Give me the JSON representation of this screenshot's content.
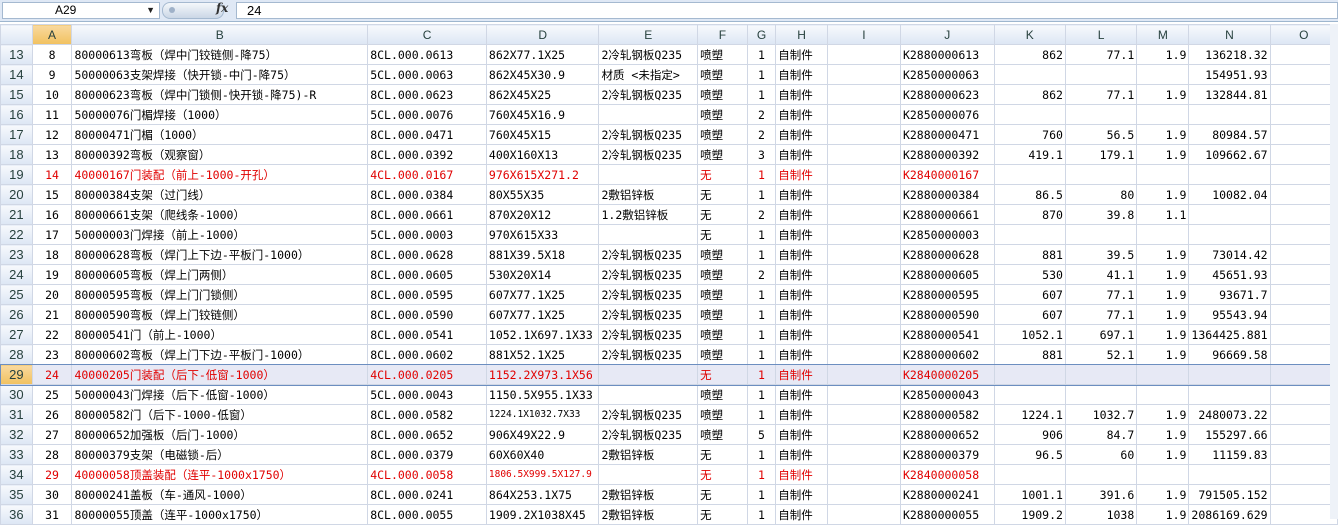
{
  "formula_bar": {
    "cell_ref": "A29",
    "fx_label": "fx",
    "value": "24"
  },
  "columns": [
    "A",
    "B",
    "C",
    "D",
    "E",
    "F",
    "G",
    "H",
    "I",
    "J",
    "K",
    "L",
    "M",
    "N",
    "O"
  ],
  "selected_column": "A",
  "selected_row": "29",
  "rows": [
    {
      "r": "13",
      "cells": [
        "8",
        "80000613弯板（焊中门铰链侧-降75）",
        "8CL.000.0613",
        "862X77.1X25",
        "2冷轧钢板Q235",
        "喷塑",
        "1",
        "自制件",
        "",
        "K2880000613",
        "862",
        "77.1",
        "1.9",
        "136218.32",
        ""
      ],
      "red": false
    },
    {
      "r": "14",
      "cells": [
        "9",
        "50000063支架焊接（快开锁-中门-降75）",
        "5CL.000.0063",
        "862X45X30.9",
        "材质 <未指定>",
        "喷塑",
        "1",
        "自制件",
        "",
        "K2850000063",
        "",
        "",
        "",
        "154951.93",
        ""
      ],
      "red": false
    },
    {
      "r": "15",
      "cells": [
        "10",
        "80000623弯板（焊中门锁侧-快开锁-降75)-R",
        "8CL.000.0623",
        "862X45X25",
        "2冷轧钢板Q235",
        "喷塑",
        "1",
        "自制件",
        "",
        "K2880000623",
        "862",
        "77.1",
        "1.9",
        "132844.81",
        ""
      ],
      "red": false
    },
    {
      "r": "16",
      "cells": [
        "11",
        "50000076门楣焊接（1000）",
        "5CL.000.0076",
        "760X45X16.9",
        "",
        "喷塑",
        "2",
        "自制件",
        "",
        "K2850000076",
        "",
        "",
        "",
        "",
        ""
      ],
      "red": false
    },
    {
      "r": "17",
      "cells": [
        "12",
        "80000471门楣（1000）",
        "8CL.000.0471",
        "760X45X15",
        "2冷轧钢板Q235",
        "喷塑",
        "2",
        "自制件",
        "",
        "K2880000471",
        "760",
        "56.5",
        "1.9",
        "80984.57",
        ""
      ],
      "red": false
    },
    {
      "r": "18",
      "cells": [
        "13",
        "80000392弯板（观察窗）",
        "8CL.000.0392",
        "400X160X13",
        "2冷轧钢板Q235",
        "喷塑",
        "3",
        "自制件",
        "",
        "K2880000392",
        "419.1",
        "179.1",
        "1.9",
        "109662.67",
        ""
      ],
      "red": false
    },
    {
      "r": "19",
      "cells": [
        "14",
        "40000167门装配（前上-1000-开孔）",
        "4CL.000.0167",
        "976X615X271.2",
        "",
        "无",
        "1",
        "自制件",
        "",
        "K2840000167",
        "",
        "",
        "",
        "",
        ""
      ],
      "red": true
    },
    {
      "r": "20",
      "cells": [
        "15",
        "80000384支架（过门线）",
        "8CL.000.0384",
        "80X55X35",
        "2敷铝锌板",
        "无",
        "1",
        "自制件",
        "",
        "K2880000384",
        "86.5",
        "80",
        "1.9",
        "10082.04",
        ""
      ],
      "red": false
    },
    {
      "r": "21",
      "cells": [
        "16",
        "80000661支架（爬线条-1000）",
        "8CL.000.0661",
        "870X20X12",
        "1.2敷铝锌板",
        "无",
        "2",
        "自制件",
        "",
        "K2880000661",
        "870",
        "39.8",
        "1.1",
        "",
        ""
      ],
      "red": false
    },
    {
      "r": "22",
      "cells": [
        "17",
        "50000003门焊接（前上-1000）",
        "5CL.000.0003",
        "970X615X33",
        "",
        "无",
        "1",
        "自制件",
        "",
        "K2850000003",
        "",
        "",
        "",
        "",
        ""
      ],
      "red": false
    },
    {
      "r": "23",
      "cells": [
        "18",
        "80000628弯板（焊门上下边-平板门-1000）",
        "8CL.000.0628",
        "881X39.5X18",
        "2冷轧钢板Q235",
        "喷塑",
        "1",
        "自制件",
        "",
        "K2880000628",
        "881",
        "39.5",
        "1.9",
        "73014.42",
        ""
      ],
      "red": false
    },
    {
      "r": "24",
      "cells": [
        "19",
        "80000605弯板（焊上门两侧）",
        "8CL.000.0605",
        "530X20X14",
        "2冷轧钢板Q235",
        "喷塑",
        "2",
        "自制件",
        "",
        "K2880000605",
        "530",
        "41.1",
        "1.9",
        "45651.93",
        ""
      ],
      "red": false
    },
    {
      "r": "25",
      "cells": [
        "20",
        "80000595弯板（焊上门门锁侧）",
        "8CL.000.0595",
        "607X77.1X25",
        "2冷轧钢板Q235",
        "喷塑",
        "1",
        "自制件",
        "",
        "K2880000595",
        "607",
        "77.1",
        "1.9",
        "93671.7",
        ""
      ],
      "red": false
    },
    {
      "r": "26",
      "cells": [
        "21",
        "80000590弯板（焊上门铰链侧）",
        "8CL.000.0590",
        "607X77.1X25",
        "2冷轧钢板Q235",
        "喷塑",
        "1",
        "自制件",
        "",
        "K2880000590",
        "607",
        "77.1",
        "1.9",
        "95543.94",
        ""
      ],
      "red": false
    },
    {
      "r": "27",
      "cells": [
        "22",
        "80000541门（前上-1000）",
        "8CL.000.0541",
        "1052.1X697.1X33",
        "2冷轧钢板Q235",
        "喷塑",
        "1",
        "自制件",
        "",
        "K2880000541",
        "1052.1",
        "697.1",
        "1.9",
        "1364425.881",
        ""
      ],
      "red": false
    },
    {
      "r": "28",
      "cells": [
        "23",
        "80000602弯板（焊上门下边-平板门-1000）",
        "8CL.000.0602",
        "881X52.1X25",
        "2冷轧钢板Q235",
        "喷塑",
        "1",
        "自制件",
        "",
        "K2880000602",
        "881",
        "52.1",
        "1.9",
        "96669.58",
        ""
      ],
      "red": false
    },
    {
      "r": "29",
      "cells": [
        "24",
        "40000205门装配（后下-低窗-1000）",
        "4CL.000.0205",
        "1152.2X973.1X56",
        "",
        "无",
        "1",
        "自制件",
        "",
        "K2840000205",
        "",
        "",
        "",
        "",
        ""
      ],
      "red": true
    },
    {
      "r": "30",
      "cells": [
        "25",
        "50000043门焊接（后下-低窗-1000）",
        "5CL.000.0043",
        "1150.5X955.1X33",
        "",
        "喷塑",
        "1",
        "自制件",
        "",
        "K2850000043",
        "",
        "",
        "",
        "",
        ""
      ],
      "red": false
    },
    {
      "r": "31",
      "cells": [
        "26",
        "80000582门（后下-1000-低窗）",
        "8CL.000.0582",
        "1224.1X1032.7X33",
        "2冷轧钢板Q235",
        "喷塑",
        "1",
        "自制件",
        "",
        "K2880000582",
        "1224.1",
        "1032.7",
        "1.9",
        "2480073.22",
        ""
      ],
      "red": false
    },
    {
      "r": "32",
      "cells": [
        "27",
        "80000652加强板（后门-1000）",
        "8CL.000.0652",
        "906X49X22.9",
        "2冷轧钢板Q235",
        "喷塑",
        "5",
        "自制件",
        "",
        "K2880000652",
        "906",
        "84.7",
        "1.9",
        "155297.66",
        ""
      ],
      "red": false
    },
    {
      "r": "33",
      "cells": [
        "28",
        "80000379支架（电磁锁-后）",
        "8CL.000.0379",
        "60X60X40",
        "2敷铝锌板",
        "无",
        "1",
        "自制件",
        "",
        "K2880000379",
        "96.5",
        "60",
        "1.9",
        "11159.83",
        ""
      ],
      "red": false
    },
    {
      "r": "34",
      "cells": [
        "29",
        "40000058顶盖装配（连平-1000x1750）",
        "4CL.000.0058",
        "1806.5X999.5X127.9",
        "",
        "无",
        "1",
        "自制件",
        "",
        "K2840000058",
        "",
        "",
        "",
        "",
        ""
      ],
      "red": true
    },
    {
      "r": "35",
      "cells": [
        "30",
        "80000241盖板（车-通风-1000）",
        "8CL.000.0241",
        "864X253.1X75",
        "2敷铝锌板",
        "无",
        "1",
        "自制件",
        "",
        "K2880000241",
        "1001.1",
        "391.6",
        "1.9",
        "791505.152",
        ""
      ],
      "red": false
    },
    {
      "r": "36",
      "cells": [
        "31",
        "80000055顶盖（连平-1000x1750）",
        "8CL.000.0055",
        "1909.2X1038X45",
        "2敷铝锌板",
        "无",
        "1",
        "自制件",
        "",
        "K2880000055",
        "1909.2",
        "1038",
        "1.9",
        "2086169.629",
        ""
      ],
      "red": false
    }
  ]
}
